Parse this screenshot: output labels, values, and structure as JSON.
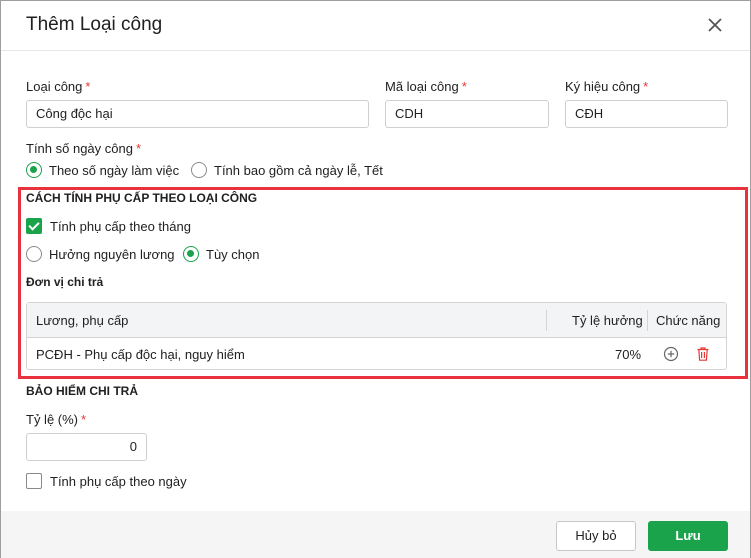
{
  "dialog": {
    "title": "Thêm Loại công",
    "close_icon": "close-icon"
  },
  "fields": {
    "loai_cong": {
      "label": "Loại công",
      "required": "*",
      "value": "Công độc hại"
    },
    "ma_loai_cong": {
      "label": "Mã loại công",
      "required": "*",
      "value": "CDH"
    },
    "ky_hieu_cong": {
      "label": "Ký hiệu công",
      "required": "*",
      "value": "CĐH"
    }
  },
  "tinh_so_ngay_cong": {
    "label": "Tính số ngày công",
    "required": "*",
    "options": [
      {
        "label": "Theo số ngày làm việc",
        "selected": true
      },
      {
        "label": "Tính bao gồm cả ngày lễ, Tết",
        "selected": false
      }
    ]
  },
  "cach_tinh": {
    "heading": "CÁCH TÍNH PHỤ CẤP THEO LOẠI CÔNG",
    "monthly_checkbox": {
      "label": "Tính phụ cấp theo tháng",
      "checked": true
    },
    "options": [
      {
        "label": "Hưởng nguyên lương",
        "selected": false
      },
      {
        "label": "Tùy chọn",
        "selected": true
      }
    ],
    "don_vi_chi_tra": "Đơn vị chi trả",
    "table": {
      "headers": [
        "Lương, phụ cấp",
        "Tỷ lệ hưởng",
        "Chức năng"
      ],
      "rows": [
        {
          "name": "PCĐH - Phụ cấp độc hại, nguy hiểm",
          "rate": "70%",
          "actions": [
            "add-circle-icon",
            "trash-icon"
          ]
        }
      ]
    }
  },
  "bao_hiem": {
    "heading": "BẢO HIỂM CHI TRẢ",
    "ty_le": {
      "label": "Tỷ lệ (%)",
      "required": "*",
      "value": "0"
    },
    "daily_checkbox": {
      "label": "Tính phụ cấp theo ngày",
      "checked": false
    }
  },
  "footer": {
    "cancel_label": "Hủy bỏ",
    "save_label": "Lưu"
  },
  "colors": {
    "accent": "#1aa34a",
    "highlight_border": "#e8333f",
    "delete_icon": "#e53935"
  }
}
